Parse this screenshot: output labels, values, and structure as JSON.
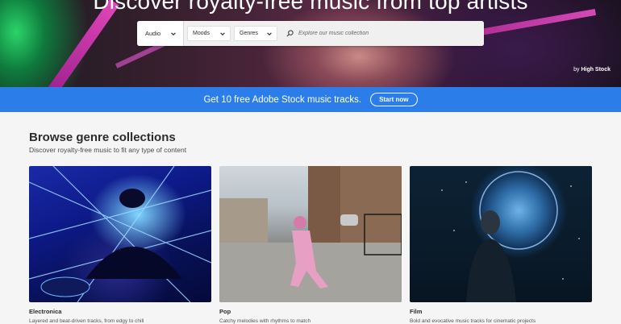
{
  "hero": {
    "title": "Discover royalty-free music from top artists",
    "credit_prefix": "by",
    "credit_name": "High Stock"
  },
  "search": {
    "type_value": "Audio",
    "moods_label": "Moods",
    "genres_label": "Genres",
    "placeholder": "Explore our music collection"
  },
  "promo": {
    "text": "Get 10 free Adobe Stock music tracks.",
    "button_label": "Start now"
  },
  "browse": {
    "title": "Browse genre collections",
    "subtitle": "Discover royalty-free music to fit any type of content"
  },
  "cards": [
    {
      "name": "Electronica",
      "desc": "Layered and beat-driven tracks, from edgy to chill"
    },
    {
      "name": "Pop",
      "desc": "Catchy melodies with rhythms to match"
    },
    {
      "name": "Film",
      "desc": "Bold and evocative music tracks for cinematic projects"
    }
  ],
  "colors": {
    "promo_blue": "#2b7de9",
    "text_dark": "#2c2c2c",
    "page_bg": "#f5f5f5"
  }
}
